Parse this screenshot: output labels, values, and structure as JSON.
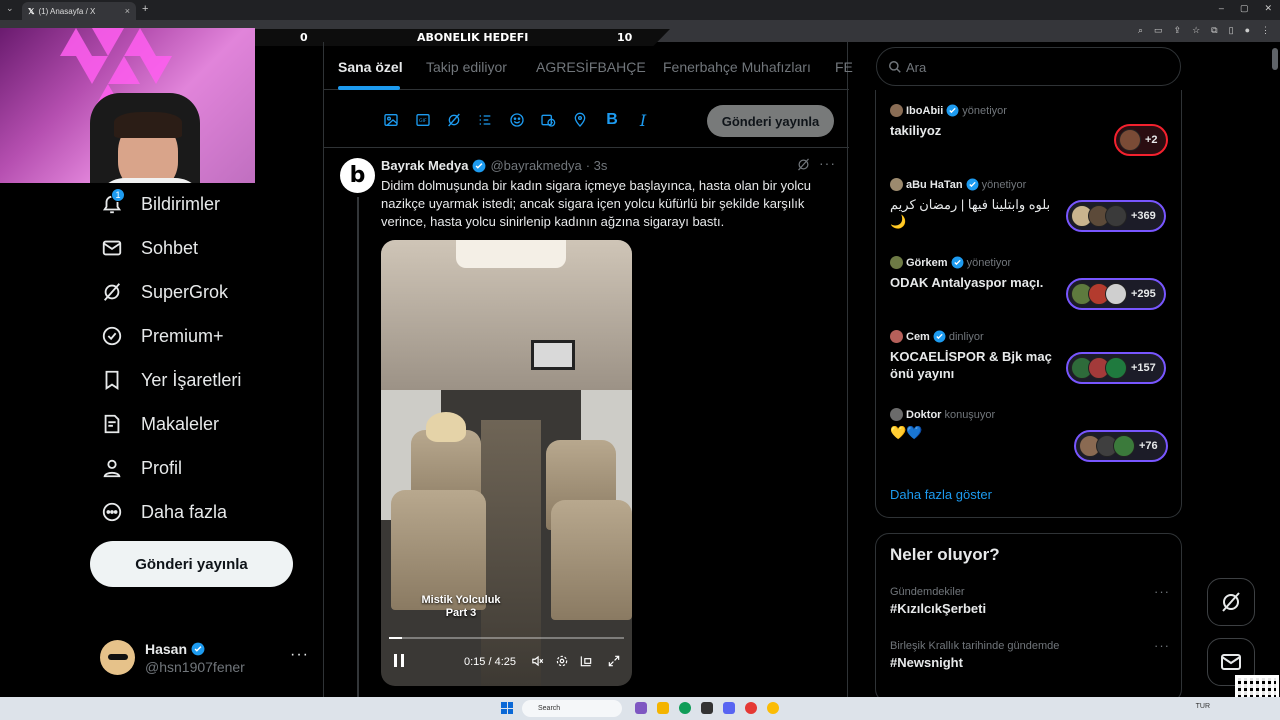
{
  "browser": {
    "tab_title": "(1) Anasayfa / X",
    "tab_close": "×",
    "new_tab": "+",
    "dropdown": "⌄",
    "window_buttons": [
      "–",
      "▢",
      "✕"
    ]
  },
  "overlay": {
    "goal_left": "0",
    "goal_label": "ABONELIK HEDEFI",
    "goal_right": "10"
  },
  "nav": {
    "badge": "1",
    "items": [
      {
        "label": "Bildirimler",
        "icon": "bell-icon"
      },
      {
        "label": "Sohbet",
        "icon": "mail-icon"
      },
      {
        "label": "SuperGrok",
        "icon": "grok-icon"
      },
      {
        "label": "Premium+",
        "icon": "verified-icon"
      },
      {
        "label": "Yer İşaretleri",
        "icon": "bookmark-icon"
      },
      {
        "label": "Makaleler",
        "icon": "articles-icon"
      },
      {
        "label": "Profil",
        "icon": "person-icon"
      },
      {
        "label": "Daha fazla",
        "icon": "more-circle-icon"
      }
    ],
    "post_button": "Gönderi yayınla"
  },
  "profile": {
    "name": "Hasan",
    "handle": "@hsn1907fener",
    "more": "···"
  },
  "feed": {
    "tabs": [
      "Sana özel",
      "Takip ediliyor",
      "AGRESİFBAHÇE",
      "Fenerbahçe Muhafızları",
      "FE"
    ],
    "active_tab": 0,
    "publish": "Gönderi yayınla",
    "post": {
      "avatar_letter": "b",
      "author": "Bayrak Medya",
      "handle": "@bayrakmedya",
      "time": "· 3s",
      "more": "···",
      "text": "Didim dolmuşunda bir kadın sigara içmeye başlayınca, hasta olan bir yolcu nazikçe uyarmak istedi; ancak sigara içen yolcu küfürlü bir şekilde karşılık verince, hasta yolcu sinirlenip kadının ağzına sigarayı bastı.",
      "video": {
        "caption_line1": "Mistik Yolculuk",
        "caption_line2": "Part 3",
        "time": "0:15 / 4:25",
        "progress": 0.057
      }
    }
  },
  "search": {
    "placeholder": "Ara"
  },
  "spaces": [
    {
      "host": "IboAbii",
      "status": "yönetiyor",
      "title": "takiliyoz",
      "count": "+2",
      "pill": "red"
    },
    {
      "host": "aBu HaTan",
      "status": "yönetiyor",
      "title": "بلوه وابتلينا فيها | رمضان كريم 🌙",
      "count": "+369",
      "pill": "purple"
    },
    {
      "host": "Görkem",
      "status": "yönetiyor",
      "title": "ODAK Antalyaspor maçı.",
      "count": "+295",
      "pill": "purple"
    },
    {
      "host": "Cem",
      "status": "dinliyor",
      "title": "KOCAELİSPOR & Bjk maç önü yayını",
      "count": "+157",
      "pill": "purple"
    },
    {
      "host": "Doktor",
      "status": "konuşuyor",
      "title": "💛💙",
      "count": "+76",
      "pill": "purple"
    }
  ],
  "show_more": "Daha fazla göster",
  "trends": {
    "title": "Neler oluyor?",
    "items": [
      {
        "context": "Gündemdekiler",
        "tag": "#KızılcıkŞerbeti"
      },
      {
        "context": "Birleşik Krallık tarihinde gündemde",
        "tag": "#Newsnight"
      }
    ],
    "more": "···"
  },
  "taskbar": {
    "search": "Search",
    "tray": "TUR"
  },
  "colors": {
    "accent": "#1d9bf0",
    "spaces_pill": "#7856ff",
    "spaces_pill_live": "#f4212e"
  }
}
